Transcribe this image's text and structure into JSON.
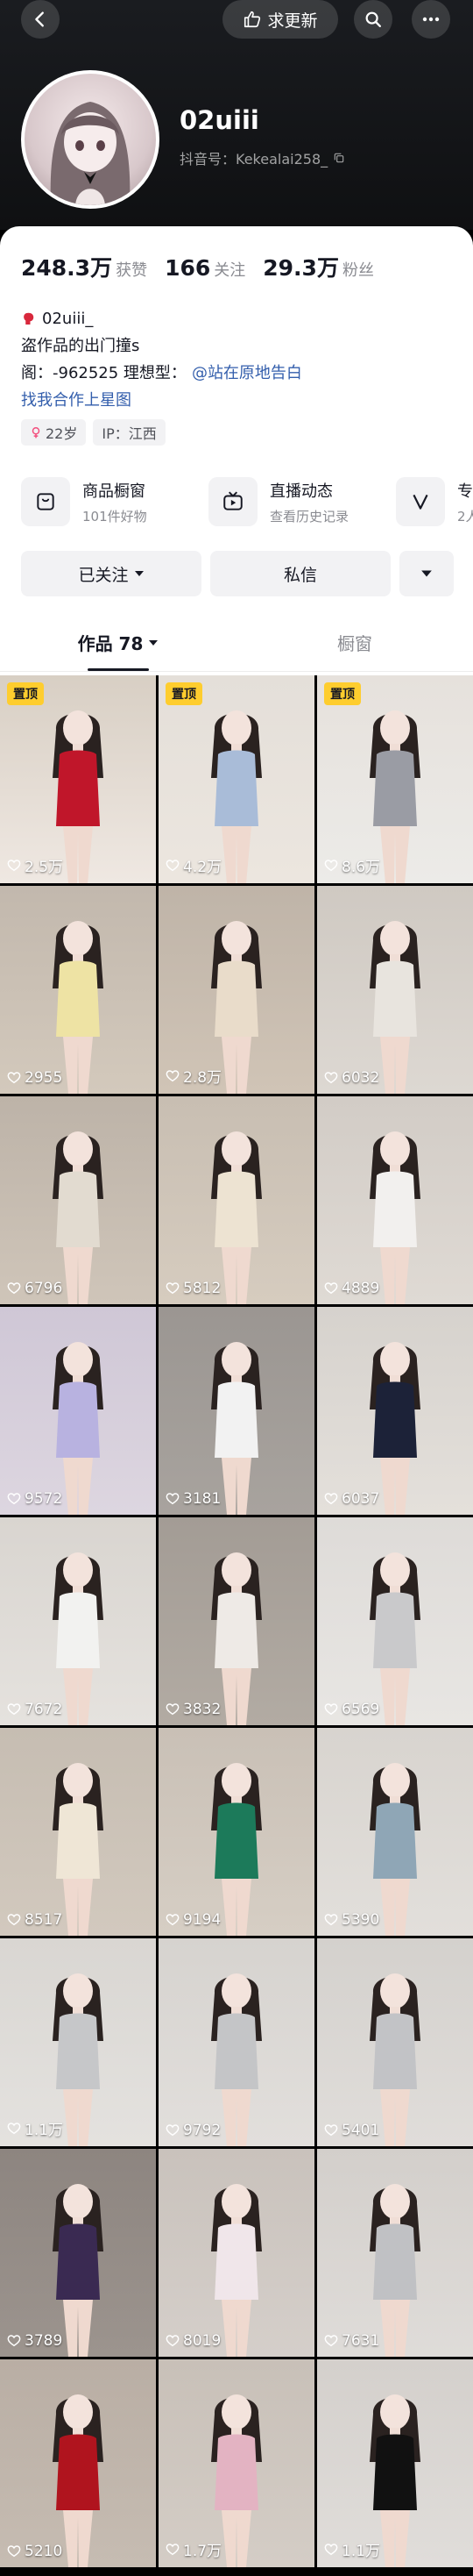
{
  "header": {
    "update_label": "求更新",
    "username": "02uiii",
    "douyin_id": "抖音号：Kekealai258_"
  },
  "stats": [
    {
      "value": "248.3万",
      "label": "获赞"
    },
    {
      "value": "166",
      "label": "关注"
    },
    {
      "value": "29.3万",
      "label": "粉丝"
    }
  ],
  "bio": {
    "line1": "02uiii_",
    "line2": "盗作品的出门撞s",
    "line3_prefix": "阁：-962525 理想型：",
    "line3_link": "@站在原地告白",
    "line4": "找我合作上星图"
  },
  "tags": {
    "age": "22岁",
    "ip": "IP：江西"
  },
  "features": [
    {
      "title": "商品橱窗",
      "sub": "101件好物",
      "icon": "shop-window-icon"
    },
    {
      "title": "直播动态",
      "sub": "查看历史记录",
      "icon": "live-tv-icon"
    },
    {
      "title": "专",
      "sub": "2人",
      "icon": "v-icon"
    }
  ],
  "actions": {
    "followed": "已关注",
    "message": "私信"
  },
  "tabs": {
    "works": "作品 78",
    "showcase": "橱窗"
  },
  "pinned_label": "置顶",
  "colors": {
    "accent_link": "#335eac",
    "pin_badge": "#fecd2e"
  },
  "videos": [
    {
      "likes": "2.5万",
      "pinned": true,
      "top": "#d8cfc4",
      "outfit": "#c0162a",
      "bg": "#efe8e2"
    },
    {
      "likes": "4.2万",
      "pinned": true,
      "top": "#e4dfd9",
      "outfit": "#a9bcd8",
      "bg": "#ece6df"
    },
    {
      "likes": "8.6万",
      "pinned": true,
      "top": "#e6e1dc",
      "outfit": "#9a9ca4",
      "bg": "#ecebe8"
    },
    {
      "likes": "2955",
      "pinned": false,
      "top": "#c2b8ad",
      "outfit": "#eee3a4",
      "bg": "#d3c9bc"
    },
    {
      "likes": "2.8万",
      "pinned": false,
      "top": "#bfb4a8",
      "outfit": "#e9dcca",
      "bg": "#d0c4b6"
    },
    {
      "likes": "6032",
      "pinned": false,
      "top": "#cfc9c2",
      "outfit": "#e8e4de",
      "bg": "#ddd8d2"
    },
    {
      "likes": "6796",
      "pinned": false,
      "top": "#bdb3a8",
      "outfit": "#e2dbd0",
      "bg": "#cfc5b9"
    },
    {
      "likes": "5812",
      "pinned": false,
      "top": "#c8beb2",
      "outfit": "#ede3d2",
      "bg": "#d6ccbf"
    },
    {
      "likes": "4889",
      "pinned": false,
      "top": "#d2ccc6",
      "outfit": "#f2f0ee",
      "bg": "#dfdad4"
    },
    {
      "likes": "9572",
      "pinned": false,
      "top": "#cfc7d6",
      "outfit": "#b8b2e0",
      "bg": "#ddd6e0"
    },
    {
      "likes": "3181",
      "pinned": false,
      "top": "#9b9692",
      "outfit": "#f2f2f2",
      "bg": "#a8a39e"
    },
    {
      "likes": "6037",
      "pinned": false,
      "top": "#d6d2cd",
      "outfit": "#1c2238",
      "bg": "#e4e0db"
    },
    {
      "likes": "7672",
      "pinned": false,
      "top": "#d9d5d0",
      "outfit": "#f2f2f0",
      "bg": "#e5e2de"
    },
    {
      "likes": "3832",
      "pinned": false,
      "top": "#a39c95",
      "outfit": "#eeeae6",
      "bg": "#b2aba3"
    },
    {
      "likes": "6569",
      "pinned": false,
      "top": "#dedbd8",
      "outfit": "#c9c9cb",
      "bg": "#e8e6e3"
    },
    {
      "likes": "8517",
      "pinned": false,
      "top": "#c6bdb2",
      "outfit": "#efe6d6",
      "bg": "#d2c9be"
    },
    {
      "likes": "9194",
      "pinned": false,
      "top": "#c9c0b6",
      "outfit": "#1c7a5a",
      "bg": "#d6cec4"
    },
    {
      "likes": "5390",
      "pinned": false,
      "top": "#d8d4cf",
      "outfit": "#8fa6b6",
      "bg": "#e2dfdb"
    },
    {
      "likes": "1.1万",
      "pinned": false,
      "top": "#d9d6d2",
      "outfit": "#c6c7c9",
      "bg": "#e4e2df"
    },
    {
      "likes": "9792",
      "pinned": false,
      "top": "#d6d3cf",
      "outfit": "#c4c5c7",
      "bg": "#e2dfdc"
    },
    {
      "likes": "5401",
      "pinned": false,
      "top": "#d4d1cd",
      "outfit": "#c2c3c6",
      "bg": "#e0ddda"
    },
    {
      "likes": "3789",
      "pinned": false,
      "top": "#8d8580",
      "outfit": "#3a2a52",
      "bg": "#9c948e"
    },
    {
      "likes": "8019",
      "pinned": false,
      "top": "#c9c2bc",
      "outfit": "#f0e6ea",
      "bg": "#d5cfca"
    },
    {
      "likes": "7631",
      "pinned": false,
      "top": "#d3cfcb",
      "outfit": "#c0c1c4",
      "bg": "#dfdcd9"
    },
    {
      "likes": "5210",
      "pinned": false,
      "top": "#b9aea4",
      "outfit": "#b0141e",
      "bg": "#c6bcb2"
    },
    {
      "likes": "1.7万",
      "pinned": false,
      "top": "#c8c0b8",
      "outfit": "#e3b3c2",
      "bg": "#d4cdc6"
    },
    {
      "likes": "1.1万",
      "pinned": false,
      "top": "#d4d0cc",
      "outfit": "#111111",
      "bg": "#e0ddda"
    }
  ]
}
